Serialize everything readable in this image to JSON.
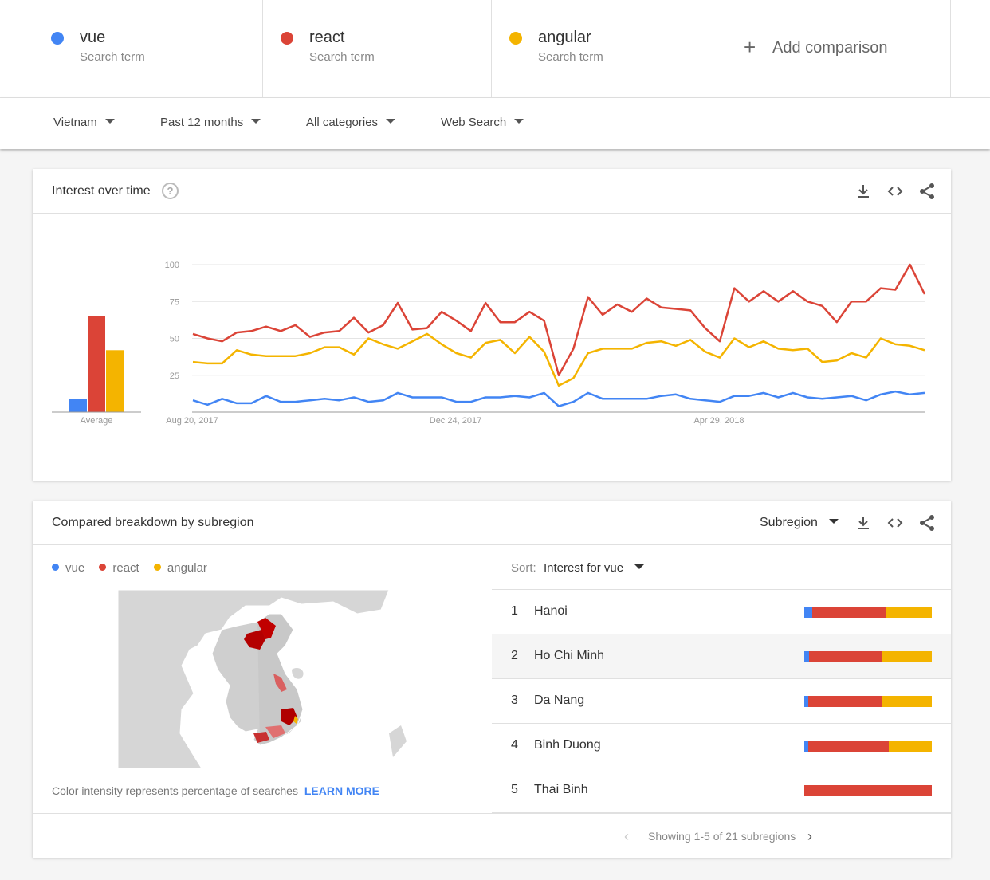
{
  "terms": [
    {
      "name": "vue",
      "sub": "Search term",
      "color": "#4285f4"
    },
    {
      "name": "react",
      "sub": "Search term",
      "color": "#db4437"
    },
    {
      "name": "angular",
      "sub": "Search term",
      "color": "#f4b400"
    }
  ],
  "add_comparison": "Add comparison",
  "filters": {
    "location": "Vietnam",
    "time": "Past 12 months",
    "category": "All categories",
    "search_type": "Web Search"
  },
  "interest_card": {
    "title": "Interest over time",
    "icons": [
      "download-icon",
      "embed-code-icon",
      "share-icon"
    ]
  },
  "chart_data": {
    "type": "line",
    "ylim": [
      0,
      100
    ],
    "yticks": [
      25,
      50,
      75,
      100
    ],
    "xtick_labels": [
      "Aug 20, 2017",
      "Dec 24, 2017",
      "Apr 29, 2018"
    ],
    "grid": true,
    "series": [
      {
        "name": "vue",
        "color": "#4285f4",
        "values": [
          8,
          5,
          9,
          6,
          6,
          11,
          7,
          7,
          8,
          9,
          8,
          10,
          7,
          8,
          13,
          10,
          10,
          10,
          7,
          7,
          10,
          10,
          11,
          10,
          13,
          4,
          7,
          13,
          9,
          9,
          9,
          9,
          11,
          12,
          9,
          8,
          7,
          11,
          11,
          13,
          10,
          13,
          10,
          9,
          10,
          11,
          8,
          12,
          14,
          12,
          13
        ]
      },
      {
        "name": "react",
        "color": "#db4437",
        "values": [
          53,
          50,
          48,
          54,
          55,
          58,
          55,
          59,
          51,
          54,
          55,
          64,
          54,
          59,
          74,
          56,
          57,
          68,
          62,
          55,
          74,
          61,
          61,
          68,
          62,
          25,
          43,
          78,
          66,
          73,
          68,
          77,
          71,
          70,
          69,
          57,
          48,
          84,
          75,
          82,
          75,
          82,
          75,
          72,
          61,
          75,
          75,
          84,
          83,
          100,
          80
        ]
      },
      {
        "name": "angular",
        "color": "#f4b400",
        "values": [
          34,
          33,
          33,
          42,
          39,
          38,
          38,
          38,
          40,
          44,
          44,
          39,
          50,
          46,
          43,
          48,
          53,
          46,
          40,
          37,
          47,
          49,
          40,
          51,
          41,
          18,
          23,
          40,
          43,
          43,
          43,
          47,
          48,
          45,
          49,
          41,
          37,
          50,
          44,
          48,
          43,
          42,
          43,
          34,
          35,
          40,
          37,
          50,
          46,
          45,
          42
        ]
      }
    ],
    "average": {
      "label": "Average",
      "values": [
        9,
        65,
        42
      ]
    }
  },
  "subregion_card": {
    "title": "Compared breakdown by subregion",
    "dropdown": "Subregion",
    "icons": [
      "download-icon",
      "embed-code-icon",
      "share-icon"
    ],
    "legend": [
      "vue",
      "react",
      "angular"
    ],
    "footnote": "Color intensity represents percentage of searches",
    "learn_more": "LEARN MORE",
    "sort_label": "Sort:",
    "sort_value": "Interest for vue",
    "rows": [
      {
        "rank": "1",
        "name": "Hanoi",
        "shares": [
          6,
          58,
          36
        ]
      },
      {
        "rank": "2",
        "name": "Ho Chi Minh",
        "shares": [
          4,
          57,
          39
        ]
      },
      {
        "rank": "3",
        "name": "Da Nang",
        "shares": [
          3,
          58,
          39
        ]
      },
      {
        "rank": "4",
        "name": "Binh Duong",
        "shares": [
          3,
          63,
          34
        ]
      },
      {
        "rank": "5",
        "name": "Thai Binh",
        "shares": [
          0,
          100,
          0
        ]
      }
    ],
    "pager_text": "Showing 1-5 of 21 subregions"
  }
}
